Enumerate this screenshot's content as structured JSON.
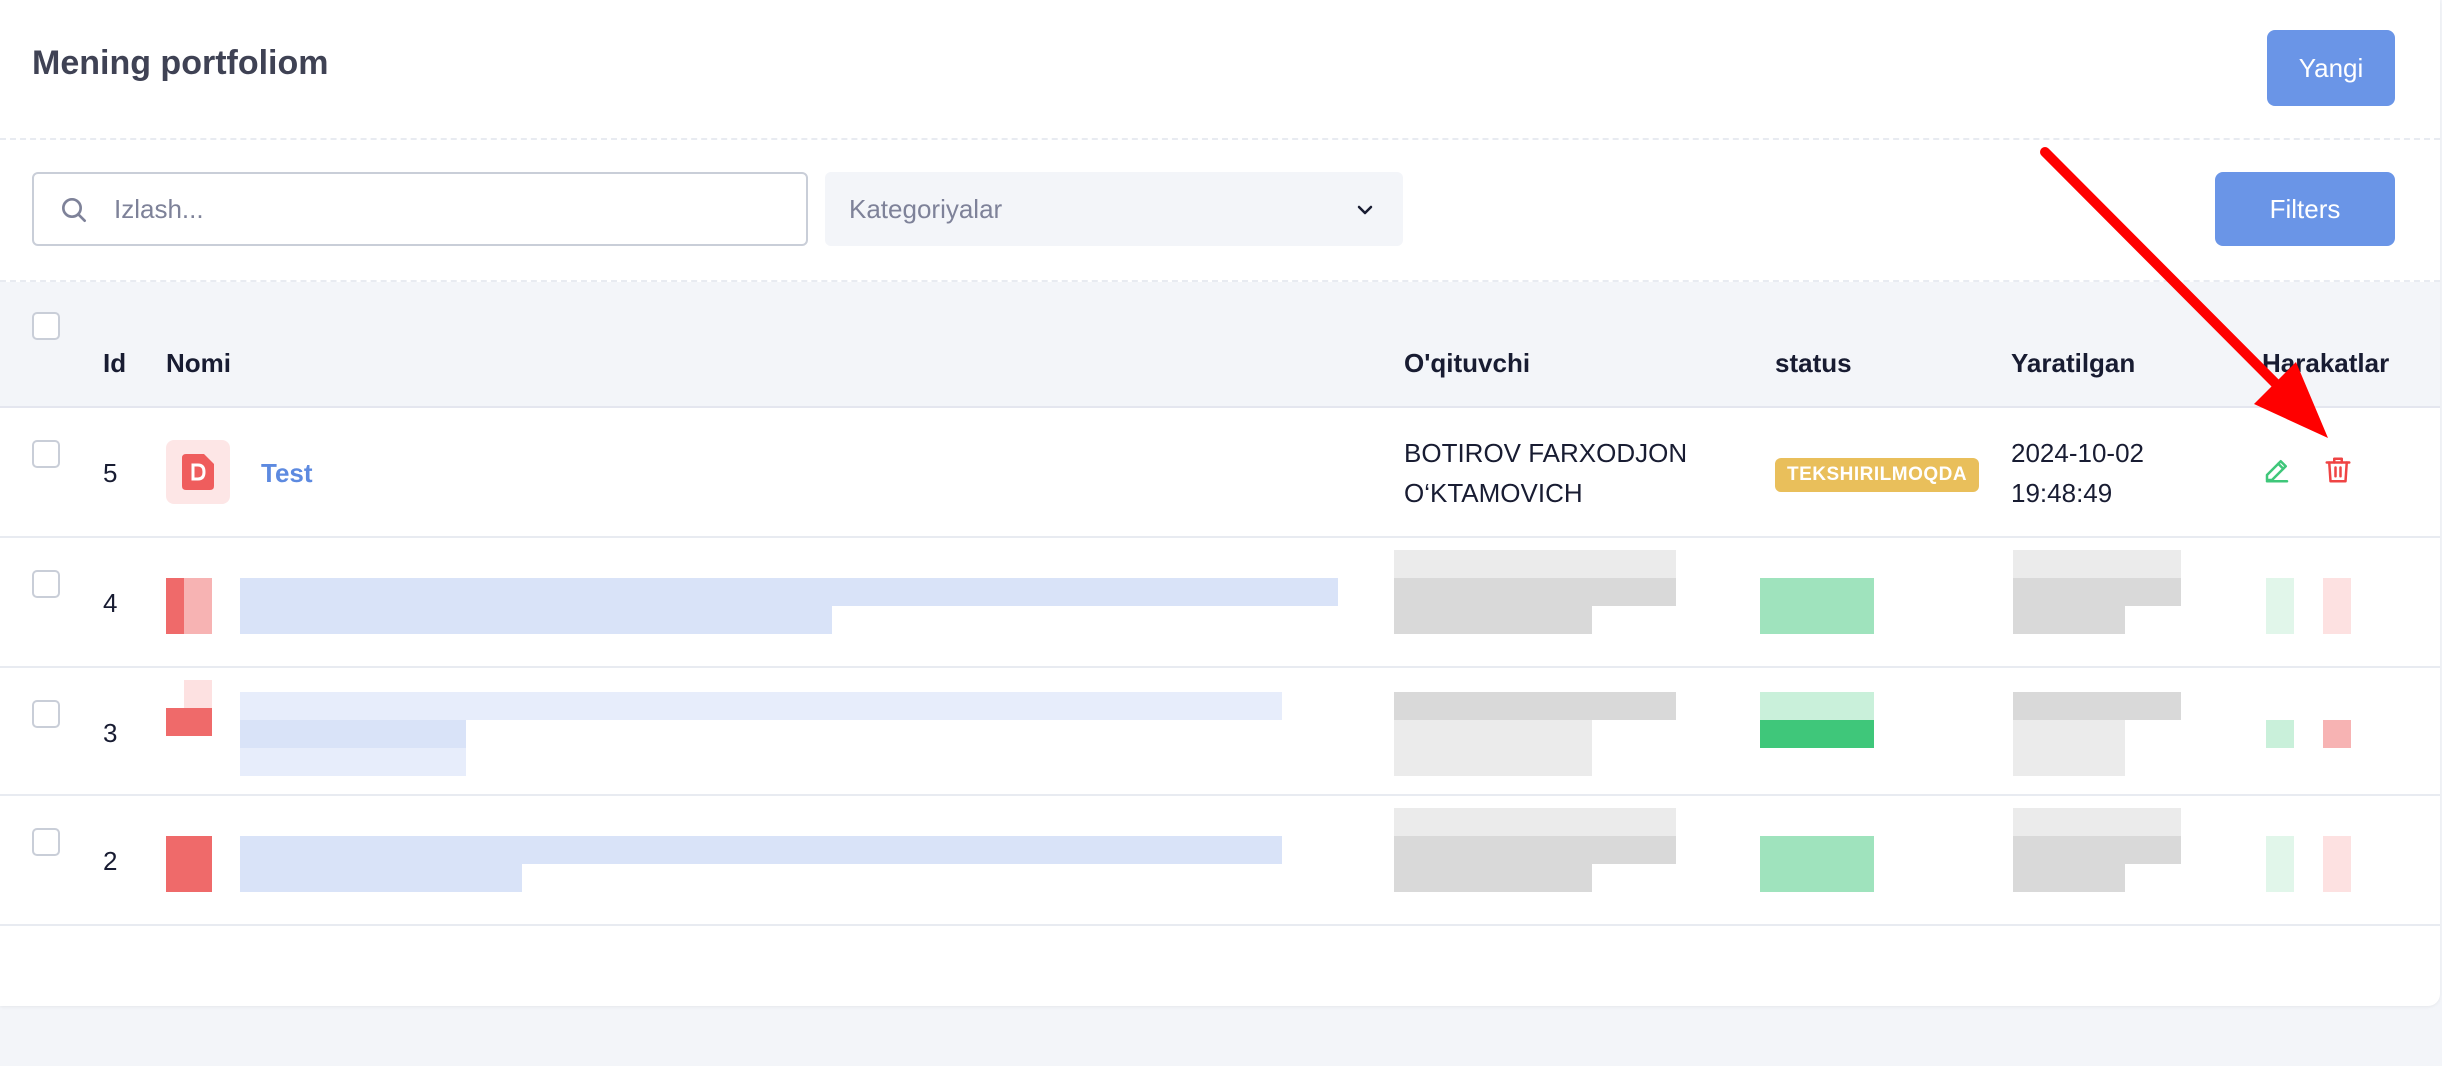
{
  "header": {
    "title": "Mening portfoliom",
    "new_button": "Yangi"
  },
  "toolbar": {
    "search_placeholder": "Izlash...",
    "category_select": "Kategoriyalar",
    "filters_button": "Filters"
  },
  "table": {
    "columns": [
      "Id",
      "Nomi",
      "O'qituvchi",
      "status",
      "Yaratilgan",
      "Harakatlar"
    ],
    "rows": [
      {
        "id": "5",
        "name": "Test",
        "teacher_line1": "BOTIROV FARXODJON",
        "teacher_line2": "O‘KTAMOVICH",
        "status": "TEKSHIRILMOQDA",
        "created_date": "2024-10-02",
        "created_time": "19:48:49"
      },
      {
        "id": "4"
      },
      {
        "id": "3"
      },
      {
        "id": "2"
      }
    ]
  },
  "colors": {
    "primary": "#6a95e7",
    "status_pending": "#e9bf5b",
    "edit": "#3fc77a",
    "delete": "#ef4444",
    "annotation_arrow": "#ff0000"
  },
  "icons": [
    "search-icon",
    "chevron-down-icon",
    "file-icon",
    "edit-icon",
    "trash-icon"
  ]
}
